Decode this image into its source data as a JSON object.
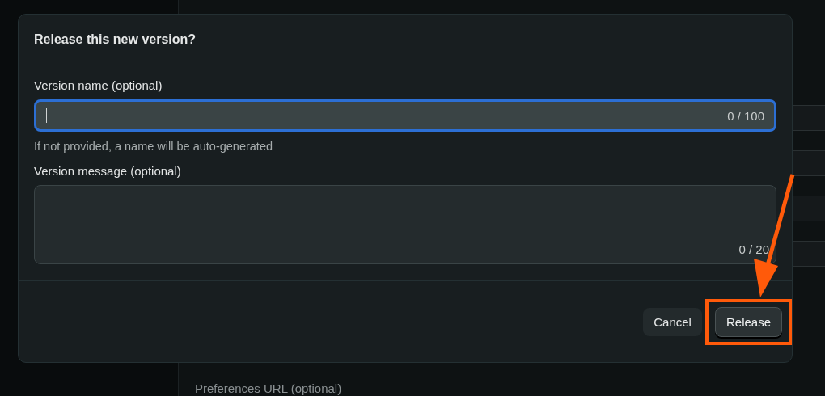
{
  "background": {
    "field_label": "Preferences URL (optional)"
  },
  "dialog": {
    "title": "Release this new version?",
    "fields": [
      {
        "kind": "input",
        "label": "Version name (optional)",
        "counter": "0 / 100",
        "focused": true,
        "help": "If not provided, a name will be auto-generated"
      },
      {
        "kind": "textarea",
        "label": "Version message (optional)",
        "counter": "0 / 20",
        "focused": false
      }
    ],
    "buttons": [
      {
        "label": "Cancel",
        "primary": false,
        "highlighted": false
      },
      {
        "label": "Release",
        "primary": true,
        "highlighted": true
      }
    ]
  }
}
